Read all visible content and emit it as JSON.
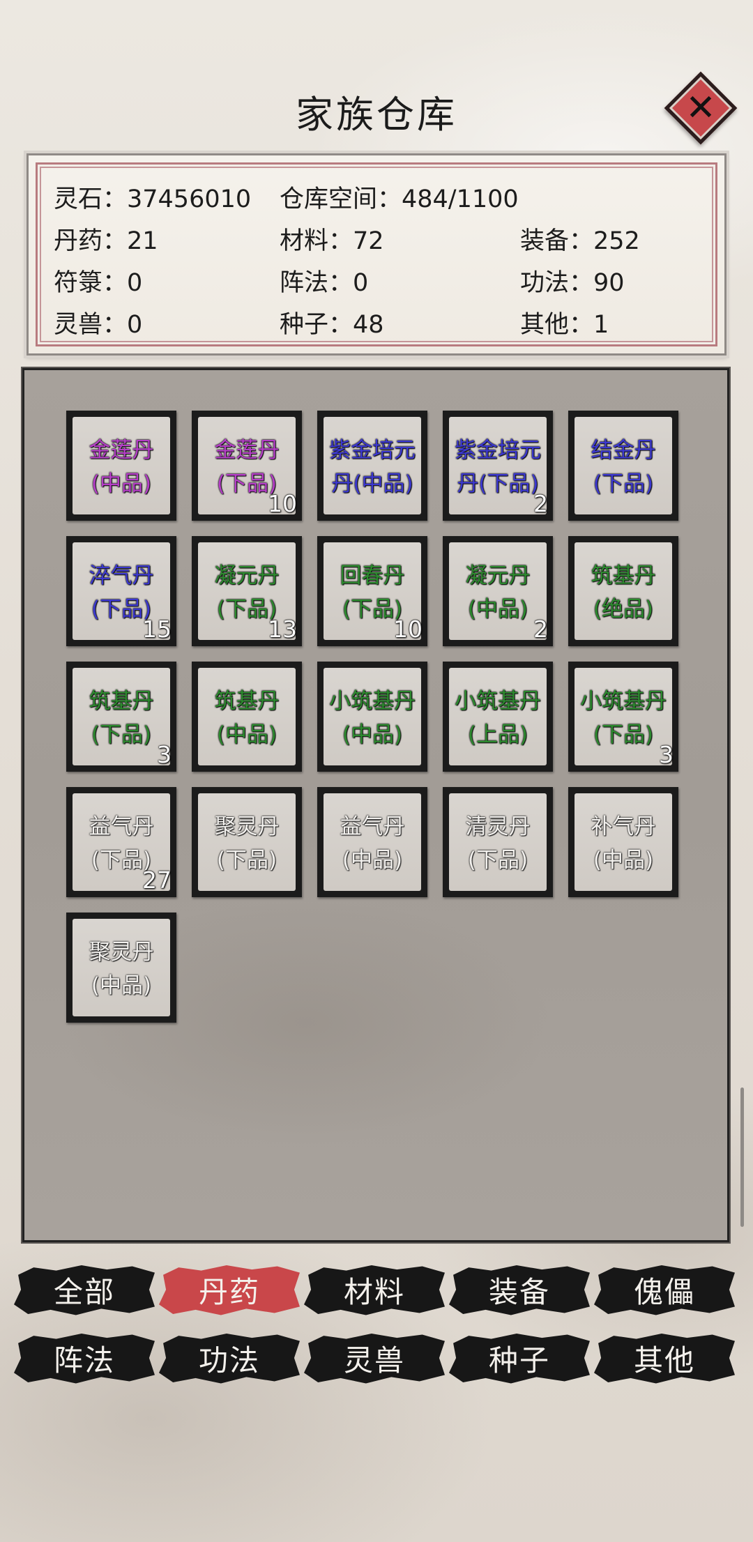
{
  "header": {
    "title": "家族仓库",
    "close_symbol": "✕"
  },
  "stats": {
    "row1": [
      "灵石：37456010",
      "仓库空间：484/1100"
    ],
    "row2": [
      "丹药：21",
      "材料：72",
      "装备：252"
    ],
    "row3": [
      "符箓：0",
      "阵法：0",
      "功法：90"
    ],
    "row4": [
      "灵兽：0",
      "种子：48",
      "其他：1"
    ]
  },
  "items": [
    {
      "line1": "金莲丹",
      "line2": "(中品)",
      "quality": "purple",
      "count": ""
    },
    {
      "line1": "金莲丹",
      "line2": "(下品)",
      "quality": "purple",
      "count": "10"
    },
    {
      "line1": "紫金培元",
      "line2": "丹(中品)",
      "quality": "blue",
      "count": ""
    },
    {
      "line1": "紫金培元",
      "line2": "丹(下品)",
      "quality": "blue",
      "count": "2"
    },
    {
      "line1": "结金丹",
      "line2": "(下品)",
      "quality": "blue",
      "count": ""
    },
    {
      "line1": "淬气丹",
      "line2": "(下品)",
      "quality": "blue",
      "count": "15"
    },
    {
      "line1": "凝元丹",
      "line2": "(下品)",
      "quality": "green",
      "count": "13"
    },
    {
      "line1": "回春丹",
      "line2": "(下品)",
      "quality": "green",
      "count": "10"
    },
    {
      "line1": "凝元丹",
      "line2": "(中品)",
      "quality": "green",
      "count": "2"
    },
    {
      "line1": "筑基丹",
      "line2": "(绝品)",
      "quality": "green",
      "count": ""
    },
    {
      "line1": "筑基丹",
      "line2": "(下品)",
      "quality": "green",
      "count": "3"
    },
    {
      "line1": "筑基丹",
      "line2": "(中品)",
      "quality": "green",
      "count": ""
    },
    {
      "line1": "小筑基丹",
      "line2": "(中品)",
      "quality": "green",
      "count": ""
    },
    {
      "line1": "小筑基丹",
      "line2": "(上品)",
      "quality": "green",
      "count": ""
    },
    {
      "line1": "小筑基丹",
      "line2": "(下品)",
      "quality": "green",
      "count": "3"
    },
    {
      "line1": "益气丹",
      "line2": "(下品)",
      "quality": "white",
      "count": "27"
    },
    {
      "line1": "聚灵丹",
      "line2": "(下品)",
      "quality": "white",
      "count": ""
    },
    {
      "line1": "益气丹",
      "line2": "(中品)",
      "quality": "white",
      "count": ""
    },
    {
      "line1": "清灵丹",
      "line2": "(下品)",
      "quality": "white",
      "count": ""
    },
    {
      "line1": "补气丹",
      "line2": "(中品)",
      "quality": "white",
      "count": ""
    },
    {
      "line1": "聚灵丹",
      "line2": "(中品)",
      "quality": "white",
      "count": ""
    }
  ],
  "tabs": {
    "row1": [
      "全部",
      "丹药",
      "材料",
      "装备",
      "傀儡"
    ],
    "row2": [
      "阵法",
      "功法",
      "灵兽",
      "种子",
      "其他"
    ],
    "active": "丹药"
  },
  "colors": {
    "purple": "#b63ec8",
    "blue": "#3c38d0",
    "green": "#2c8a2e",
    "white": "#f3f1ee",
    "active_tab": "#c9474a",
    "close_button": "#c7484b"
  }
}
